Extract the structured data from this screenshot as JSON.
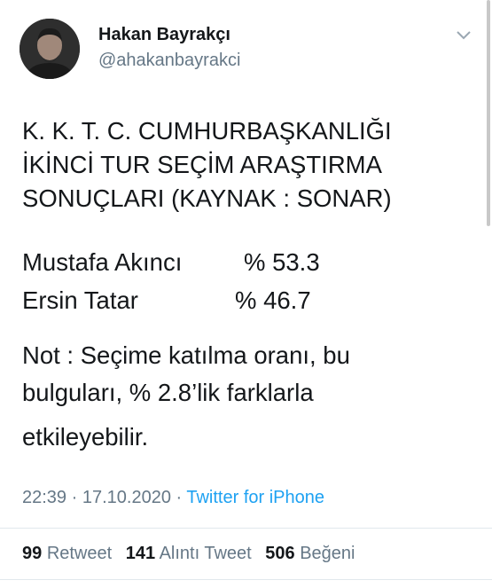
{
  "author": {
    "name": "Hakan Bayrakçı",
    "handle": "@ahakanbayrakci"
  },
  "icons": {
    "avatar": "profile-photo",
    "menu": "chevron-down-icon"
  },
  "tweet": {
    "line1": "K. K. T. C. CUMHURBAŞKANLIĞI",
    "line2": "İKİNCİ TUR SEÇİM ARAŞTIRMA",
    "line3": "SONUÇLARI (KAYNAK : SONAR)",
    "candidates": [
      {
        "name": "Mustafa Akıncı",
        "percent": "% 53.3"
      },
      {
        "name": "Ersin Tatar",
        "percent": "% 46.7"
      }
    ],
    "note1": "Not : Seçime katılma oranı, bu",
    "note2": "bulguları, % 2.8’lik farklarla",
    "note3": "etkileyebilir."
  },
  "meta": {
    "time": "22:39",
    "sep1": " · ",
    "date": "17.10.2020",
    "sep2": " · ",
    "source": "Twitter for iPhone"
  },
  "stats": {
    "retweets_count": "99",
    "retweets_label": "Retweet",
    "quotes_count": "141",
    "quotes_label": "Alıntı Tweet",
    "likes_count": "506",
    "likes_label": "Beğeni"
  },
  "colors": {
    "text": "#14171a",
    "secondary": "#657786",
    "link": "#1da1f2",
    "divider": "#e1e8ed"
  }
}
